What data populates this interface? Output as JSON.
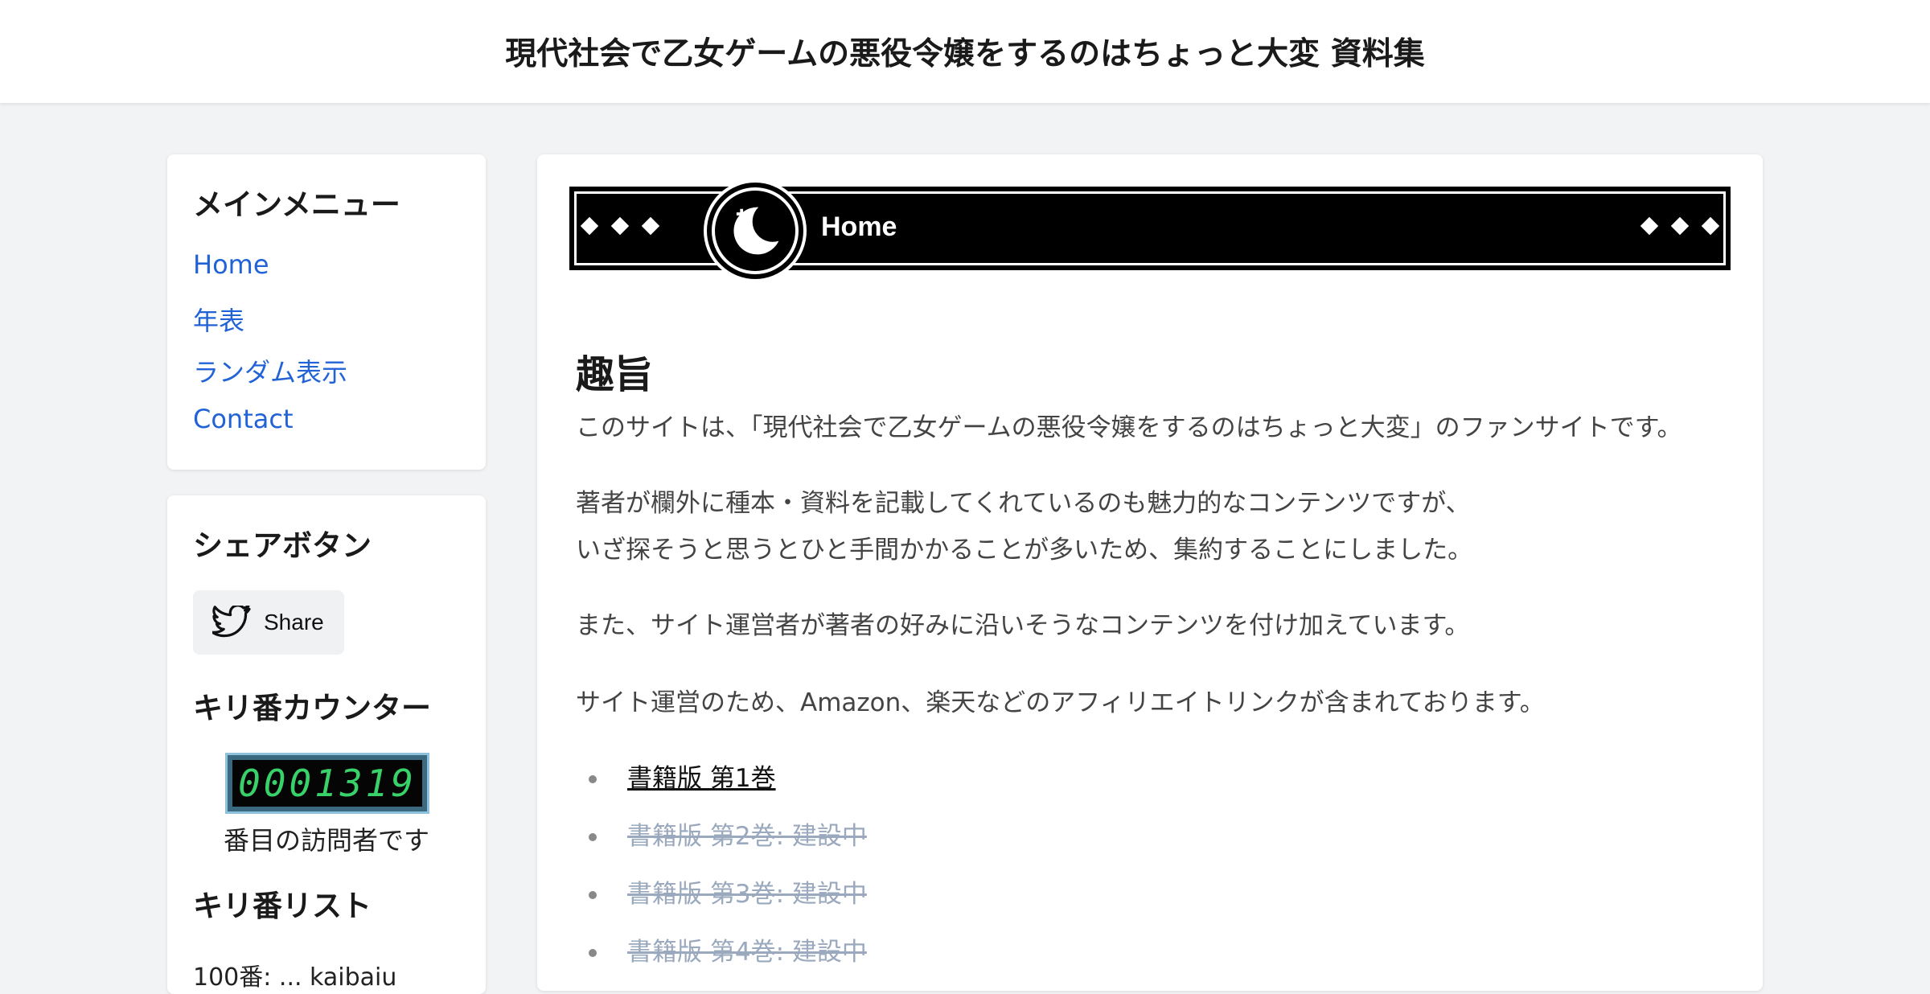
{
  "header": {
    "title": "現代社会で乙女ゲームの悪役令嬢をするのはちょっと大変 資料集"
  },
  "sidebar": {
    "menu_title": "メインメニュー",
    "menu_items": [
      "Home",
      "年表",
      "ランダム表示",
      "Contact"
    ],
    "share_title": "シェアボタン",
    "share_button": "Share",
    "counter_title": "キリ番カウンター",
    "counter_value": "0001319",
    "counter_suffix": "番目の訪問者です",
    "kiri_title": "キリ番リスト",
    "kiri_first_item": "100番: ... kaibaiu"
  },
  "banner": {
    "label": "Home"
  },
  "main": {
    "section_title": "趣旨",
    "paragraphs": [
      "このサイトは、「現代社会で乙女ゲームの悪役令嬢をするのはちょっと大変」のファンサイトです。",
      "著者が欄外に種本・資料を記載してくれているのも魅力的なコンテンツですが、",
      "いざ探そうと思うとひと手間かかることが多いため、集約することにしました。",
      "また、サイト運営者が著者の好みに沿いそうなコンテンツを付け加えています。",
      "サイト運営のため、Amazon、楽天などのアフィリエイトリンクが含まれております。"
    ],
    "books": [
      "書籍版 第1巻",
      "書籍版 第2巻: 建設中",
      "書籍版 第3巻: 建設中",
      "書籍版 第4巻: 建設中"
    ]
  },
  "colors": {
    "link": "#2163d7",
    "counter_digits": "#39d26a",
    "disabled": "#9aa9bd"
  },
  "icons": [
    "twitter-icon",
    "moon-emblem-icon",
    "diamond-icon"
  ]
}
